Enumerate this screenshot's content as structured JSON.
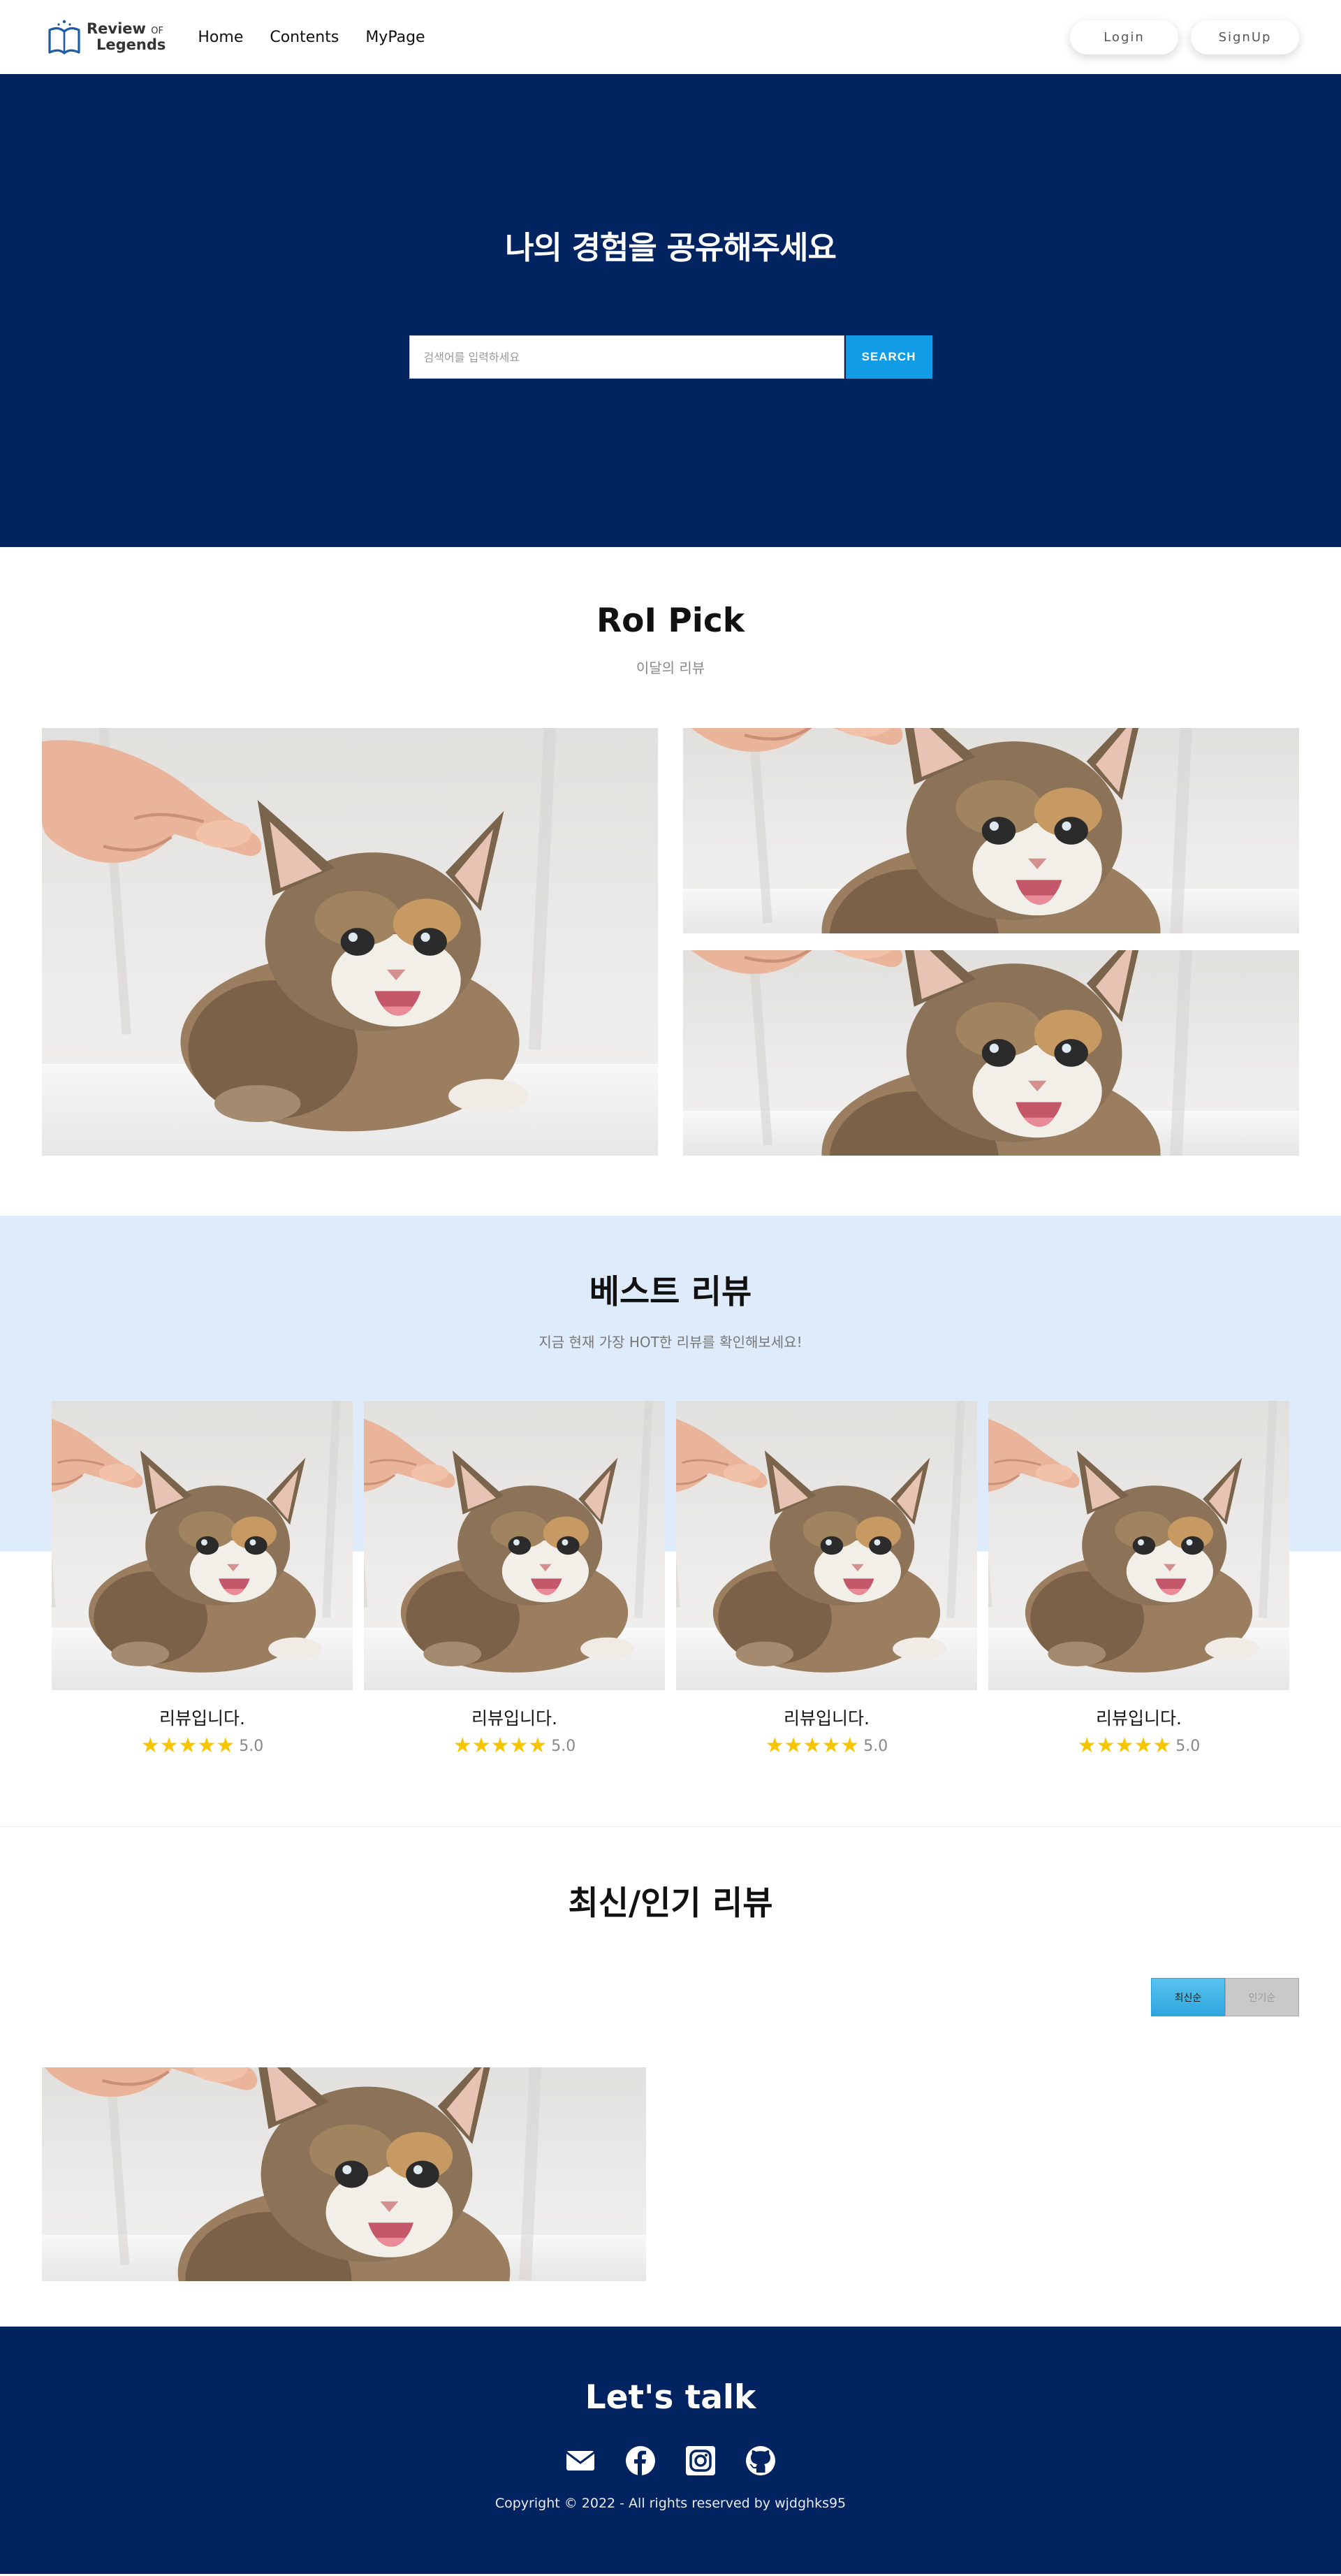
{
  "header": {
    "logo": {
      "line1": "Review",
      "line1_small": "OF",
      "line2": "Legends"
    },
    "nav": [
      {
        "label": "Home"
      },
      {
        "label": "Contents"
      },
      {
        "label": "MyPage"
      }
    ],
    "login_label": "Login",
    "signup_label": "SignUp"
  },
  "hero": {
    "title": "나의 경험을 공유해주세요",
    "search_placeholder": "검색어를 입력하세요",
    "search_button": "SEARCH"
  },
  "pick": {
    "title": "RoI Pick",
    "subtitle": "이달의 리뷰"
  },
  "best": {
    "title": "베스트 리뷰",
    "subtitle": "지금 현재 가장 HOT한 리뷰를 확인해보세요!",
    "cards": [
      {
        "title": "리뷰입니다.",
        "rating": "5.0",
        "stars": 5
      },
      {
        "title": "리뷰입니다.",
        "rating": "5.0",
        "stars": 5
      },
      {
        "title": "리뷰입니다.",
        "rating": "5.0",
        "stars": 5
      },
      {
        "title": "리뷰입니다.",
        "rating": "5.0",
        "stars": 5
      }
    ]
  },
  "latest": {
    "title": "최신/인기 리뷰",
    "sort_latest": "최신순",
    "sort_popular": "인기순"
  },
  "footer": {
    "title": "Let's talk",
    "icons": [
      "mail-icon",
      "facebook-icon",
      "instagram-icon",
      "github-icon"
    ],
    "copyright": "Copyright © 2022 - All rights reserved by wjdghks95"
  },
  "colors": {
    "navy": "#012460",
    "search_blue": "#139ce6",
    "best_bg": "#deebfb",
    "star": "#f7c400"
  }
}
